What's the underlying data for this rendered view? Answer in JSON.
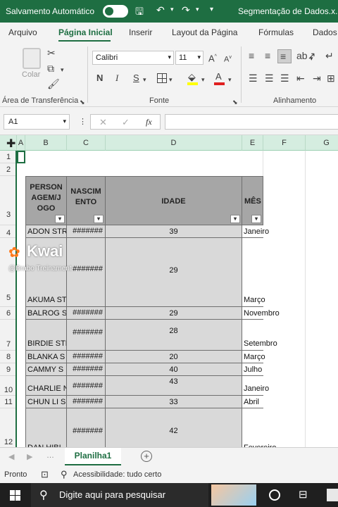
{
  "titlebar": {
    "autosave_label": "Salvamento Automático",
    "doc_title": "Segmentação de Dados.x..."
  },
  "ribbon_tabs": [
    "Arquivo",
    "Página Inicial",
    "Inserir",
    "Layout da Página",
    "Fórmulas",
    "Dados"
  ],
  "ribbon": {
    "paste_label": "Colar",
    "clipboard_label": "Área de Transferência",
    "font_name": "Calibri",
    "font_size": "11",
    "font_group_label": "Fonte",
    "alignment_label": "Alinhamento",
    "bold": "N",
    "italic": "I",
    "underline": "S"
  },
  "formula_bar": {
    "name_box": "A1",
    "fx": "fx",
    "cancel": "✕",
    "confirm": "✓"
  },
  "columns": [
    "A",
    "B",
    "C",
    "D",
    "E",
    "F",
    "G"
  ],
  "rows": [
    "1",
    "2",
    "3",
    "4",
    "5",
    "6",
    "7",
    "8",
    "9",
    "10",
    "11",
    "12"
  ],
  "table_headers": {
    "personagem": "PERSON AGEM/J OGO",
    "nascimento": "NASCIM ENTO",
    "idade": "IDADE",
    "mes": "MÊS"
  },
  "table_rows": [
    {
      "name": "ADON STR",
      "birth": "#######",
      "age": "39",
      "month": "Janeiro"
    },
    {
      "name": "AKUMA ST",
      "birth": "#######",
      "age": "29",
      "month": "Março"
    },
    {
      "name": "BALROG S",
      "birth": "#######",
      "age": "29",
      "month": "Novembro"
    },
    {
      "name": "BIRDIE STR",
      "birth": "#######",
      "age": "28",
      "month": "Setembro"
    },
    {
      "name": "BLANKA S",
      "birth": "#######",
      "age": "20",
      "month": "Março"
    },
    {
      "name": "CAMMY S",
      "birth": "#######",
      "age": "40",
      "month": "Julho"
    },
    {
      "name": "CHARLIE N",
      "birth": "#######",
      "age": "43",
      "month": "Janeiro"
    },
    {
      "name": "CHUN LI S",
      "birth": "#######",
      "age": "33",
      "month": "Abril"
    },
    {
      "name": "DAN HIBI",
      "birth": "#######",
      "age": "42",
      "month": "Fevereiro"
    }
  ],
  "sheet_tab": "Planilha1",
  "status": {
    "ready": "Pronto",
    "accessibility": "Acessibilidade: tudo certo"
  },
  "taskbar": {
    "search_placeholder": "Digite aqui para pesquisar"
  },
  "overlay": {
    "brand": "Kwai",
    "subtitle": "@Brabo Treinament"
  },
  "colors": {
    "excel_green": "#1e6e42",
    "header_fill": "#a6a6a6",
    "body_fill": "#d9d9d9"
  }
}
